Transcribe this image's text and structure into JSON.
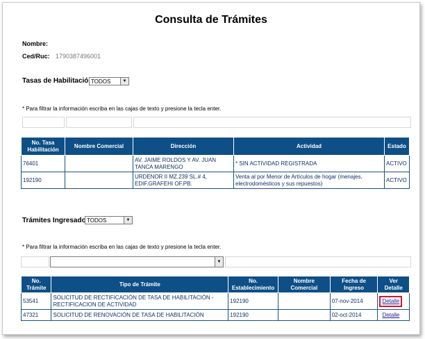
{
  "page": {
    "title": "Consulta de Trámites"
  },
  "info": {
    "nombre_label": "Nombre:",
    "nombre_value": "",
    "cedruc_label": "Ced/Ruc:",
    "cedruc_value": "1790387496001"
  },
  "tasas": {
    "label": "Tasas de Habilitación",
    "filter_value": "TODOS",
    "note": "* Para filtrar la información escriba en las cajas de texto y presione la tecla enter.",
    "headers": [
      "No. Tasa Habilitación",
      "Nombre Comercial",
      "Dirección",
      "Actividad",
      "Estado"
    ],
    "rows": [
      {
        "no": "76401",
        "nombre": "",
        "direccion": "AV. JAIME ROLDOS Y AV. JUAN TANCA MARENGO",
        "actividad": "* SIN ACTIVIDAD REGISTRADA",
        "estado": "ACTIVO"
      },
      {
        "no": "192190",
        "nombre": "",
        "direccion": "URDENOR II MZ.239 SL.# 4, EDIF.GRAFEHI OF.PB.",
        "actividad": "Venta al por Menor de Artículos de hogar (menajes, electrodomésticos y sus repuestos)",
        "estado": "ACTIVO"
      }
    ]
  },
  "tramites": {
    "label": "Trámites Ingresados",
    "filter_value": "TODOS",
    "note": "* Para filtrar la información escriba en las cajas de texto y presione la tecla enter.",
    "headers": [
      "No. Trámite",
      "Tipo de Trámite",
      "No. Establecimiento",
      "Nombre Comercial",
      "Fecha de Ingreso",
      "Ver Detalle"
    ],
    "rows": [
      {
        "no": "53541",
        "tipo": "SOLICITUD DE RECTIFICACIÓN DE TASA DE HABILITACIÓN - RECTIFICACION DE ACTIVIDAD",
        "establecimiento": "192190",
        "nombre": "",
        "fecha": "07-nov-2014",
        "detalle": "Detalle"
      },
      {
        "no": "47321",
        "tipo": "SOLICITUD DE RENOVACIÓN DE TASA DE HABILITACIÓN",
        "establecimiento": "192190",
        "nombre": "",
        "fecha": "02-oct-2014",
        "detalle": "Detalle"
      }
    ]
  },
  "colors": {
    "header_bg": "#0d4f86",
    "highlight": "#d6152a"
  },
  "icons": {
    "dropdown": "chevron-down-icon"
  }
}
